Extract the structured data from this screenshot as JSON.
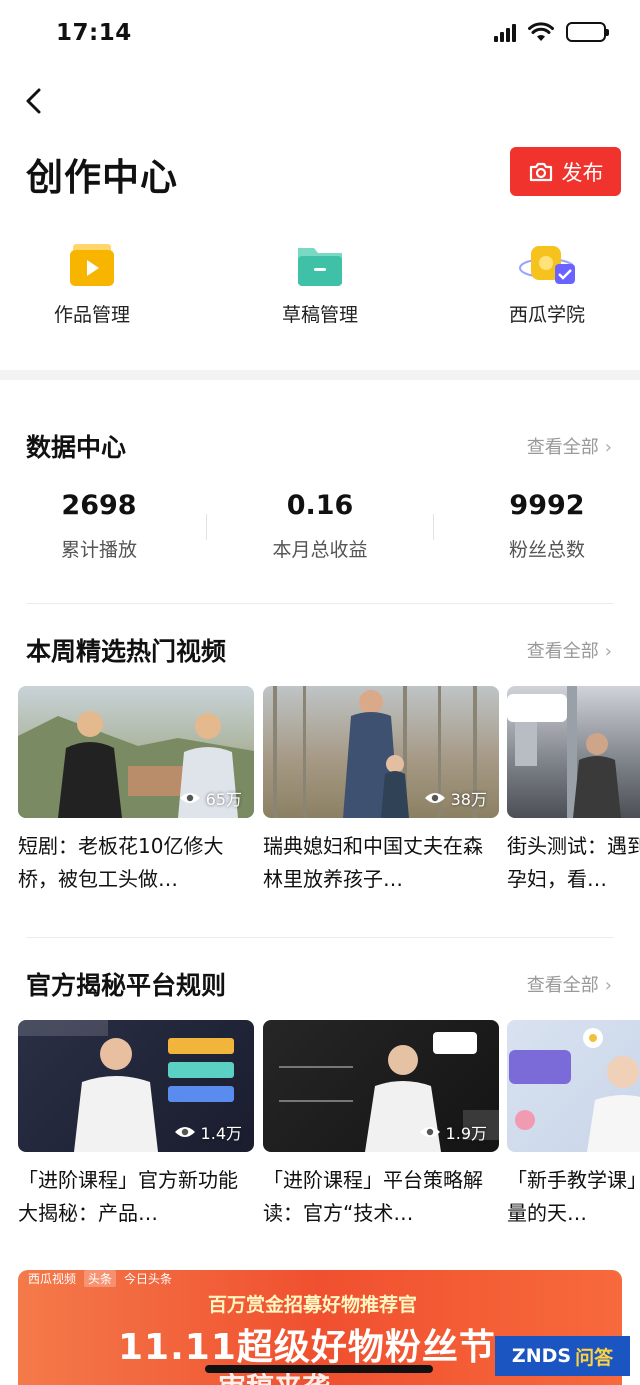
{
  "status_bar": {
    "time": "17:14"
  },
  "header": {
    "title": "创作中心",
    "publish_label": "发布"
  },
  "quick_entries": [
    {
      "label": "作品管理",
      "icon": "play-folder-icon",
      "color": "#f7b500"
    },
    {
      "label": "草稿管理",
      "icon": "folder-icon",
      "color": "#3ec1a6"
    },
    {
      "label": "西瓜学院",
      "icon": "academy-icon",
      "color": "#f6c21e"
    }
  ],
  "data_center": {
    "title": "数据中心",
    "see_all": "查看全部",
    "stats": [
      {
        "value": "2698",
        "label": "累计播放"
      },
      {
        "value": "0.16",
        "label": "本月总收益"
      },
      {
        "value": "9992",
        "label": "粉丝总数"
      }
    ]
  },
  "hot_videos": {
    "title": "本周精选热门视频",
    "see_all": "查看全部",
    "items": [
      {
        "title": "短剧：老板花10亿修大桥，被包工头做…",
        "views": "65万"
      },
      {
        "title": "瑞典媳妇和中国丈夫在森林里放养孩子…",
        "views": "38万"
      },
      {
        "title": "街头测试：遇到让座子的孕妇，看…",
        "views": ""
      }
    ]
  },
  "official_rules": {
    "title": "官方揭秘平台规则",
    "see_all": "查看全部",
    "items": [
      {
        "title": "「进阶课程」官方新功能大揭秘：产品…",
        "views": "1.4万"
      },
      {
        "title": "「进阶课程」平台策略解读：官方“技术…",
        "views": "1.9万"
      },
      {
        "title": "「新手教学课」提升播放量的天…",
        "views": ""
      }
    ]
  },
  "banner": {
    "brand": "西瓜视频",
    "brand_tag": "头条",
    "brand2": "今日头条",
    "subtitle": "百万赏金招募好物推荐官",
    "headline": "11.11超级好物粉丝节",
    "headline2": "审稿来袭"
  },
  "watermark": {
    "a": "ZNDS",
    "b": "问答"
  },
  "colors": {
    "accent": "#f0332c",
    "muted": "#999999"
  }
}
